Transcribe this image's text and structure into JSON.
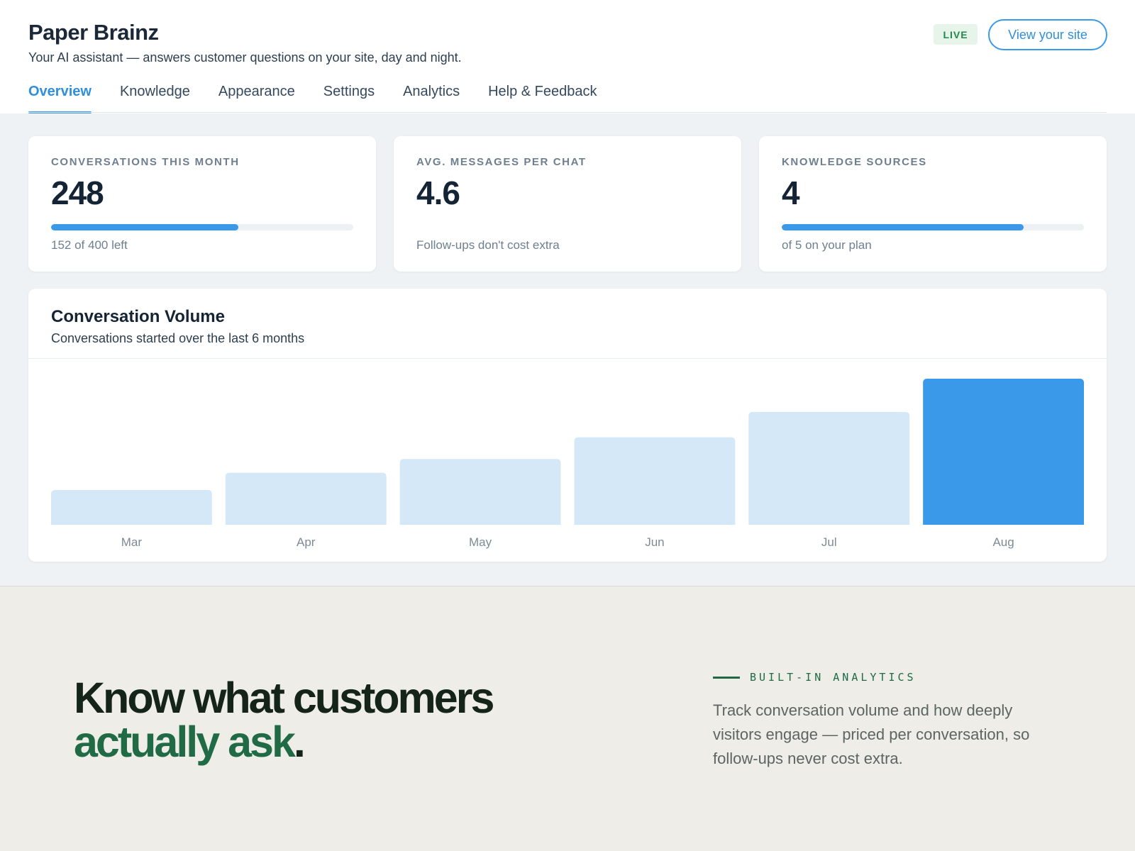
{
  "header": {
    "title": "Paper Brainz",
    "subtitle": "Your AI assistant — answers customer questions on your site, day and night.",
    "status_badge": "LIVE",
    "view_site_label": "View your site"
  },
  "tabs": [
    {
      "label": "Overview",
      "active": true
    },
    {
      "label": "Knowledge",
      "active": false
    },
    {
      "label": "Appearance",
      "active": false
    },
    {
      "label": "Settings",
      "active": false
    },
    {
      "label": "Analytics",
      "active": false
    },
    {
      "label": "Help & Feedback",
      "active": false
    }
  ],
  "stats": [
    {
      "label": "CONVERSATIONS THIS MONTH",
      "value": "248",
      "caption": "152 of 400 left",
      "progress": 0.62
    },
    {
      "label": "AVG. MESSAGES PER CHAT",
      "value": "4.6",
      "caption": "Follow-ups don't cost extra",
      "progress": null
    },
    {
      "label": "KNOWLEDGE SOURCES",
      "value": "4",
      "caption": "of 5 on your plan",
      "progress": 0.8
    }
  ],
  "chart": {
    "title": "Conversation Volume",
    "subtitle": "Conversations started over the last 6 months"
  },
  "chart_data": {
    "type": "bar",
    "title": "Conversation Volume",
    "subtitle": "Conversations started over the last 6 months",
    "categories": [
      "Mar",
      "Apr",
      "May",
      "Jun",
      "Jul",
      "Aug"
    ],
    "values": [
      48,
      72,
      91,
      121,
      156,
      202
    ],
    "highlight_index": 5,
    "grid": false,
    "colors": {
      "bar": "#d5e8f8",
      "highlight": "#3a99e8",
      "tick": "#7d8a96"
    }
  },
  "promo": {
    "headline_line1": "Know what customers",
    "headline_accent": "actually ask",
    "headline_end": ".",
    "eyebrow": "BUILT-IN ANALYTICS",
    "body": "Track conversation volume and how deeply visitors engage — priced per conversation, so follow-ups never cost extra."
  },
  "colors": {
    "accent": "#3a99e8",
    "live_badge_bg": "#e6f4ea",
    "live_badge_text": "#1f8a4c",
    "promo_accent": "#206b45",
    "page_bg": "#eef2f5",
    "promo_bg": "#eeede7"
  }
}
